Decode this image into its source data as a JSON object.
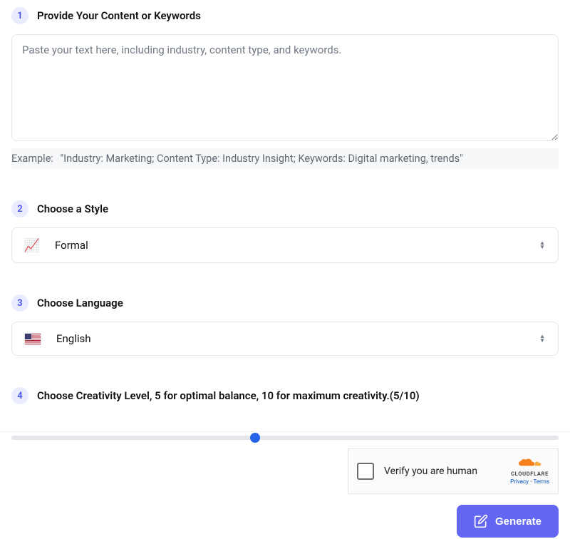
{
  "step1": {
    "number": "1",
    "title": "Provide Your Content or Keywords",
    "placeholder": "Paste your text here, including industry, content type, and keywords.",
    "example_label": "Example:",
    "example_text": "\"Industry: Marketing; Content Type: Industry Insight; Keywords: Digital marketing, trends\""
  },
  "step2": {
    "number": "2",
    "title": "Choose a Style",
    "icon": "📈",
    "value": "Formal"
  },
  "step3": {
    "number": "3",
    "title": "Choose Language",
    "value": "English"
  },
  "step4": {
    "number": "4",
    "title": "Choose Creativity Level, 5 for optimal balance, 10 for maximum creativity.(5/10)",
    "value": 5,
    "min": 0,
    "max": 10,
    "thumb_percent": "44.5%"
  },
  "captcha": {
    "label": "Verify you are human",
    "brand": "CLOUDFLARE",
    "privacy": "Privacy",
    "terms": "Terms"
  },
  "generate_label": "Generate"
}
